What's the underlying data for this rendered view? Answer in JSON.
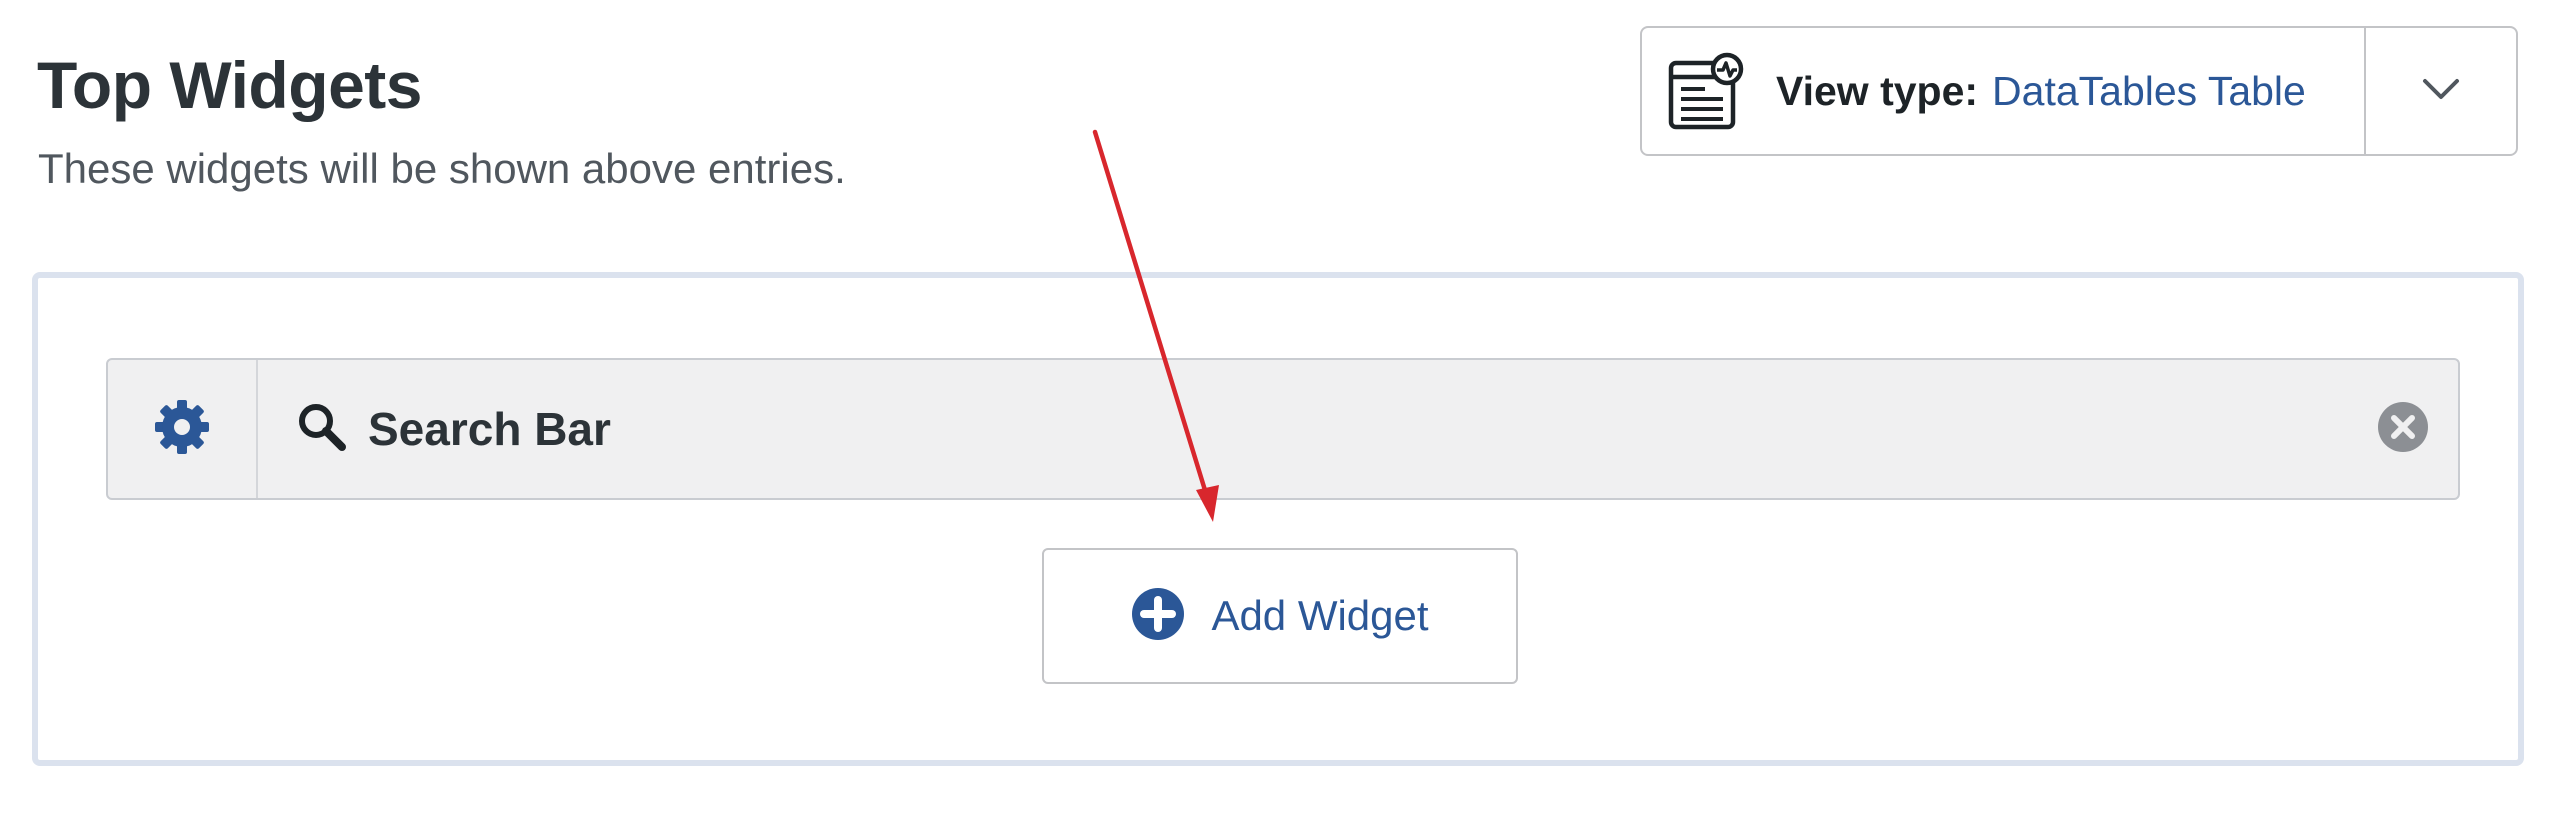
{
  "header": {
    "title": "Top Widgets",
    "description": "These widgets will be shown above entries."
  },
  "view_type": {
    "label": "View type:",
    "value": "DataTables Table",
    "icon": "table-view-icon",
    "toggle_icon": "chevron-down-icon"
  },
  "widgets": [
    {
      "label": "Search Bar",
      "icon": "search-icon",
      "settings_icon": "gear-icon",
      "remove_icon": "remove-circle-icon"
    }
  ],
  "add_widget": {
    "label": "Add Widget",
    "icon": "plus-circle-icon"
  },
  "colors": {
    "accent_blue": "#2b5797",
    "annotation_red": "#d8272d",
    "widget_row_bg": "#f0f0f1",
    "area_border": "#dbe2ee"
  }
}
